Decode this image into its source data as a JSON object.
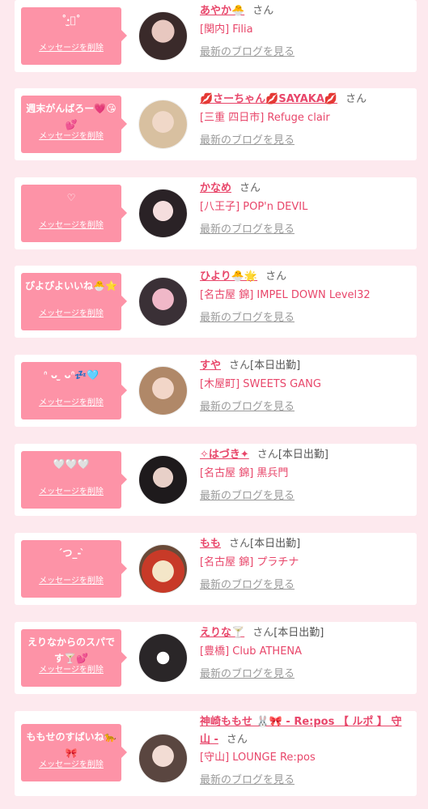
{
  "delete_label": "メッセージを削除",
  "blog_label": "最新のブログを見る",
  "honorific": "さん",
  "colors": {
    "bubble": "#fd93a7",
    "name": "#e8466a",
    "background": "#fde9ee"
  },
  "entries": [
    {
      "message": "˚‧̫͛˚",
      "name": "あやか🐣",
      "status": "",
      "shop": "[関内] Filia"
    },
    {
      "message": "週末がんばろー💗😘💕",
      "name": "💋さーちゃん💋SAYAKA💋",
      "status": "",
      "shop": "[三重 四日市] Refuge clair"
    },
    {
      "message": "♡",
      "name": "かなめ",
      "status": "",
      "shop": "[八王子] POP'n DEVIL"
    },
    {
      "message": "ぴよぴよいいね🐣⭐",
      "name": "ひより🐣🌟",
      "status": "",
      "shop": "[名古屋 錦] IMPEL DOWN Level32"
    },
    {
      "message": "ᐢ ᴗ ̫ ᴗᐢ💤🩵",
      "name": "すや",
      "status": "[本日出勤]",
      "shop": "[木屋町] SWEETS GANG"
    },
    {
      "message": "🤍🤍🤍",
      "name": "✧はづき✦",
      "status": "[本日出勤]",
      "shop": "[名古屋 錦] 黒兵門"
    },
    {
      "message": "´つ_- ̀ ",
      "name": "もも",
      "status": "[本日出勤]",
      "shop": "[名古屋 錦] プラチナ"
    },
    {
      "message": "えりなからのスパです🍸💕",
      "name": "えりな🍸",
      "status": "[本日出勤]",
      "shop": "[豊橋] Club ATHENA"
    },
    {
      "message": "ももせのすぱいね🐆🎀",
      "name": "神崎ももせ 🐰🎀 - Re:pos 【 ルポ 】 守山 -",
      "status": "",
      "shop": "[守山] LOUNGE Re:pos"
    }
  ]
}
